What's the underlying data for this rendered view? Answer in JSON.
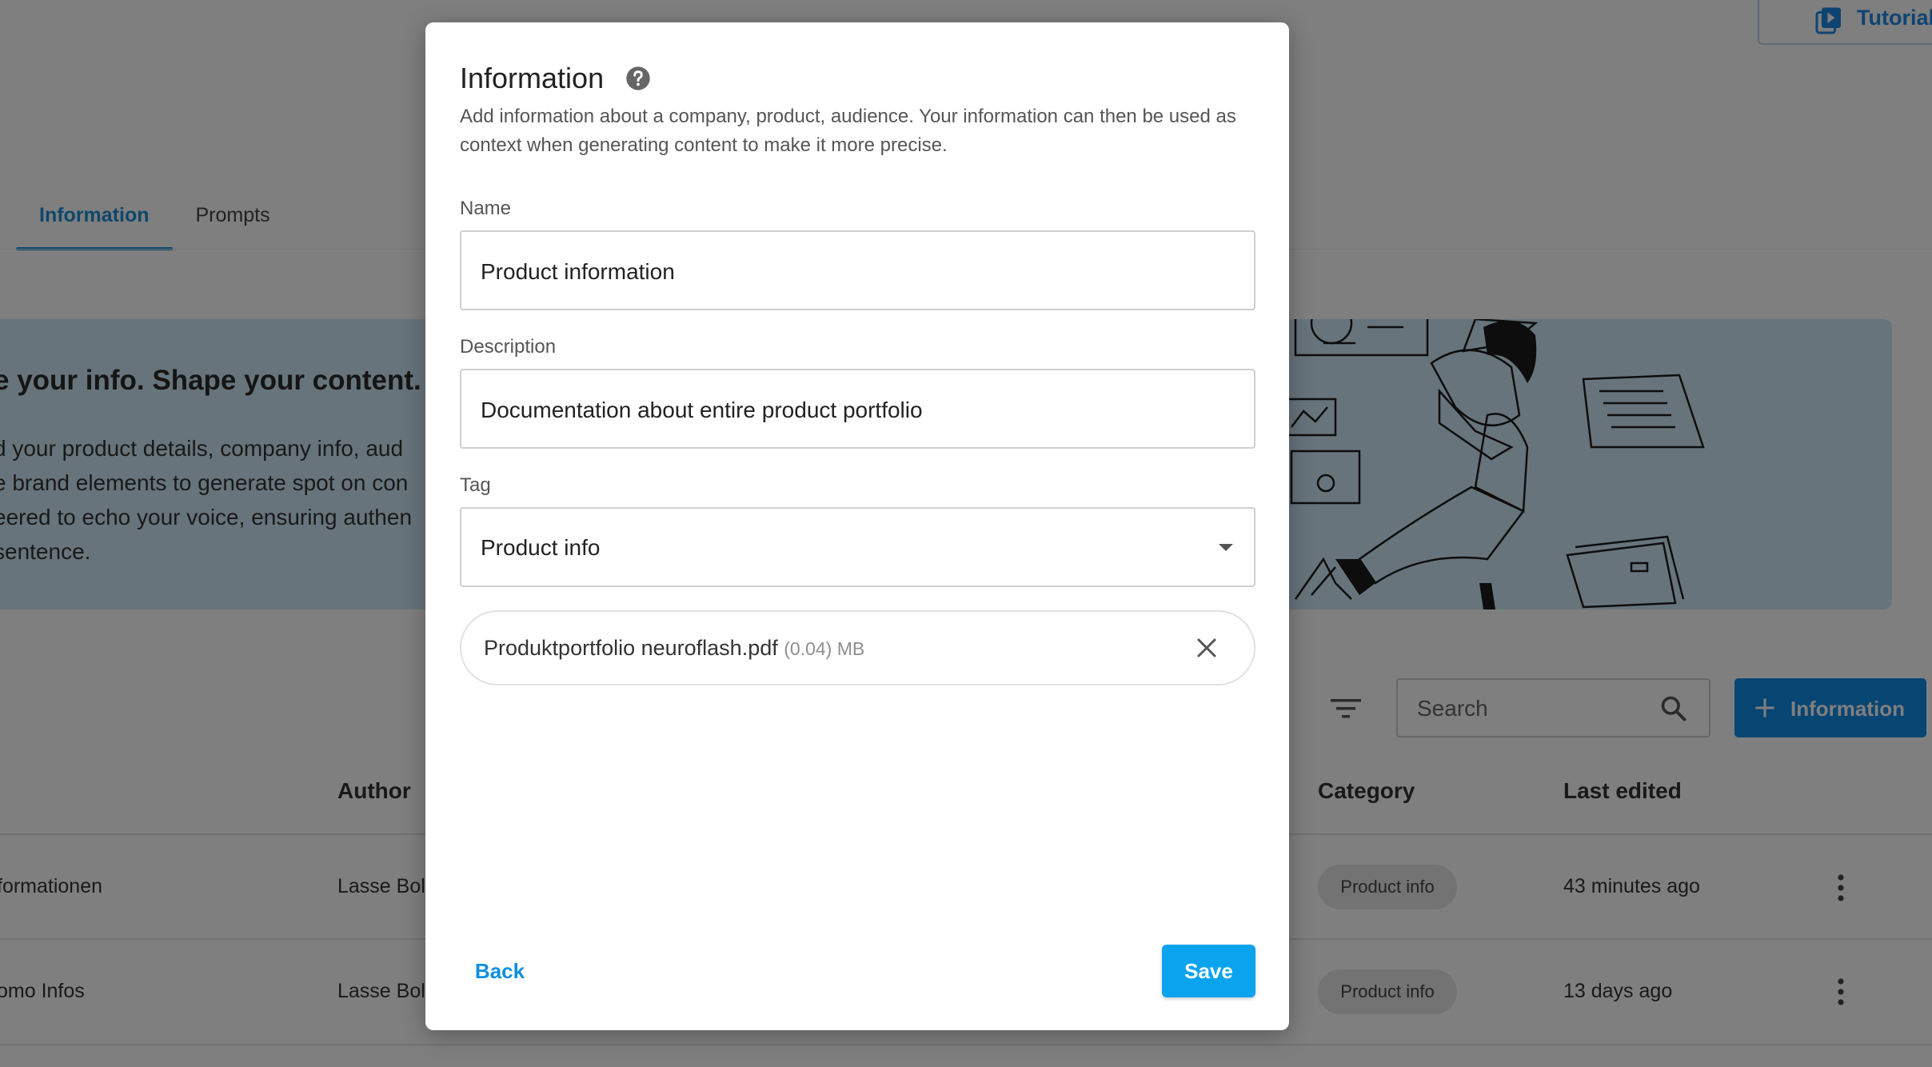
{
  "header": {
    "tutorial_label": "Tutorial"
  },
  "tabs": [
    {
      "label": "Information",
      "active": true
    },
    {
      "label": "Prompts",
      "active": false
    }
  ],
  "banner": {
    "title": "e your info. Shape your content.",
    "text": "d your product details, company info, aud\ne brand elements to generate spot on con\neered to echo your voice, ensuring authen\nsentence."
  },
  "toolbar": {
    "search_placeholder": "Search",
    "add_label": "Information"
  },
  "table": {
    "headers": {
      "author": "Author",
      "category": "Category",
      "last_edited": "Last edited"
    },
    "rows": [
      {
        "name": "formationen",
        "author": "Lasse Bol",
        "category": "Product info",
        "last_edited": "43 minutes ago"
      },
      {
        "name": "omo Infos",
        "author": "Lasse Bol",
        "category": "Product info",
        "last_edited": "13 days ago"
      }
    ]
  },
  "modal": {
    "title": "Information",
    "subtitle": "Add information about a company, product, audience. Your information can then be used as context when generating content to make it more precise.",
    "name_label": "Name",
    "name_value": "Product information",
    "description_label": "Description",
    "description_value": "Documentation about entire product portfolio",
    "tag_label": "Tag",
    "tag_value": "Product info",
    "file": {
      "name": "Produktportfolio neuroflash.pdf",
      "size": "(0.04) MB"
    },
    "back_label": "Back",
    "save_label": "Save"
  },
  "colors": {
    "accent": "#1f8fd6",
    "primary_button": "#0f8be6",
    "save_button": "#0aa4ee",
    "banner_bg": "#cfe9f7"
  }
}
